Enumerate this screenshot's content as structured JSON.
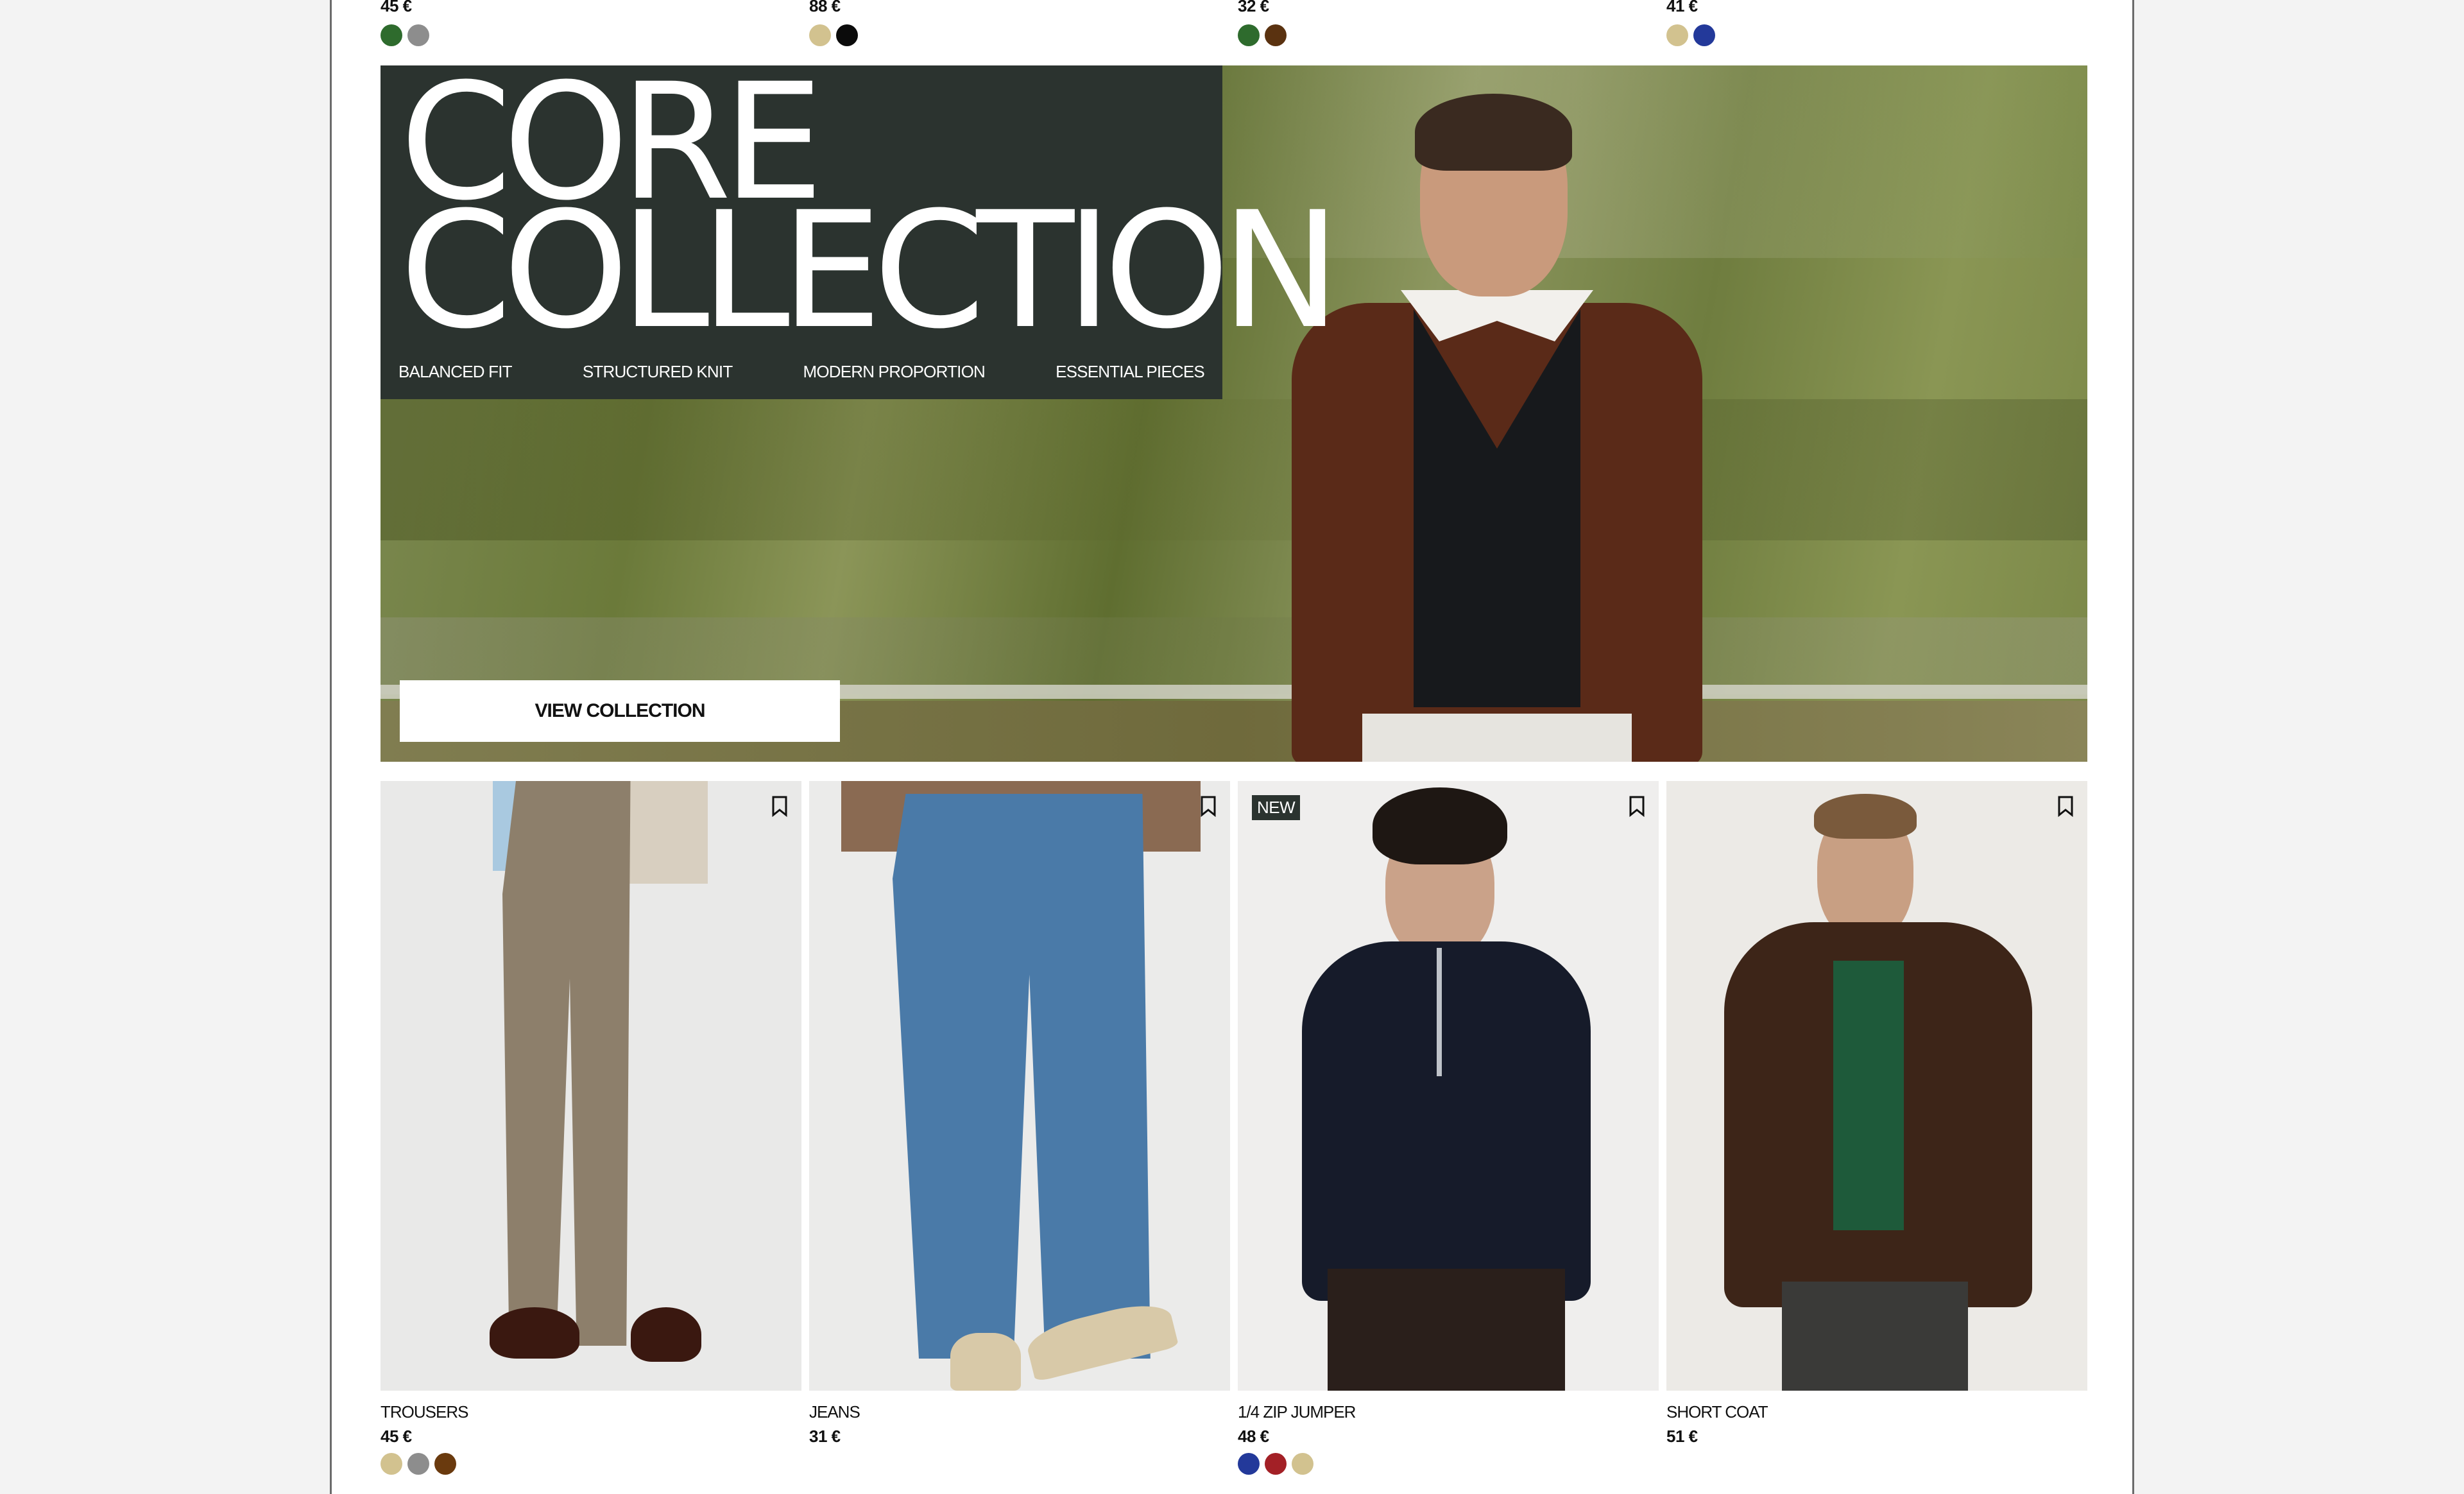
{
  "top_row": [
    {
      "price": "45 €",
      "swatches": [
        "#2e6b2d",
        "#8d8d8d"
      ]
    },
    {
      "price": "88 €",
      "swatches": [
        "#d2c28f",
        "#0b0b0b"
      ]
    },
    {
      "price": "32 €",
      "swatches": [
        "#2e6b2d",
        "#5a3210"
      ]
    },
    {
      "price": "41 €",
      "swatches": [
        "#d2c28f",
        "#23399a"
      ]
    }
  ],
  "hero": {
    "title": "CORE\nCOLLECTION",
    "tags": [
      "BALANCED FIT",
      "STRUCTURED KNIT",
      "MODERN PROPORTION",
      "ESSENTIAL PIECES"
    ],
    "button_label": "VIEW COLLECTION"
  },
  "products": [
    {
      "name": "TROUSERS",
      "price": "45 €",
      "badge": "",
      "swatches": [
        "#d2c28f",
        "#8d8d8d",
        "#6a3a0e"
      ]
    },
    {
      "name": "JEANS",
      "price": "31 €",
      "badge": "",
      "swatches": []
    },
    {
      "name": "1/4 ZIP JUMPER",
      "price": "48 €",
      "badge": "NEW",
      "swatches": [
        "#23399a",
        "#a32026",
        "#d2c28f"
      ]
    },
    {
      "name": "SHORT COAT",
      "price": "51 €",
      "badge": "",
      "swatches": []
    }
  ],
  "icons": {
    "bookmark": "bookmark-icon"
  }
}
